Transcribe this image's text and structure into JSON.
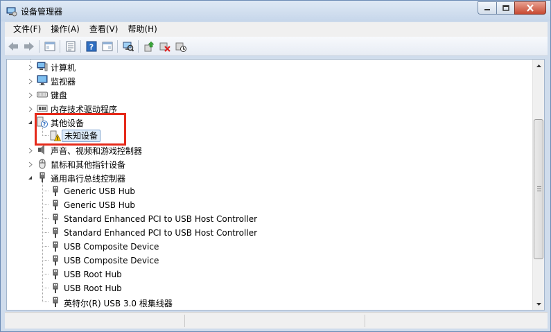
{
  "window": {
    "title": "设备管理器"
  },
  "menu": [
    "文件(F)",
    "操作(A)",
    "查看(V)",
    "帮助(H)"
  ],
  "toolbar": {
    "buttons": [
      "back-icon",
      "forward-icon",
      "show-hide-console-tree-icon",
      "properties-icon",
      "help-icon",
      "action-pane-icon",
      "scan-hardware-icon",
      "update-driver-icon",
      "uninstall-icon",
      "disable-icon"
    ]
  },
  "tree": {
    "categories": [
      {
        "label": "计算机",
        "icon": "computer-icon",
        "expanded": false
      },
      {
        "label": "监视器",
        "icon": "monitor-icon",
        "expanded": false
      },
      {
        "label": "键盘",
        "icon": "keyboard-icon",
        "expanded": false
      },
      {
        "label": "内存技术驱动程序",
        "icon": "memory-icon",
        "expanded": false
      },
      {
        "label": "其他设备",
        "icon": "unknown-device-icon",
        "expanded": true
      },
      {
        "label": "声音、视频和游戏控制器",
        "icon": "sound-icon",
        "expanded": false
      },
      {
        "label": "鼠标和其他指针设备",
        "icon": "mouse-icon",
        "expanded": false
      },
      {
        "label": "通用串行总线控制器",
        "icon": "usb-icon",
        "expanded": true
      }
    ],
    "other_devices": [
      "未知设备"
    ],
    "usb_devices": [
      "Generic USB Hub",
      "Generic USB Hub",
      "Standard Enhanced PCI to USB Host Controller",
      "Standard Enhanced PCI to USB Host Controller",
      "USB Composite Device",
      "USB Composite Device",
      "USB Root Hub",
      "USB Root Hub",
      "英特尔(R) USB 3.0 根集线器"
    ]
  },
  "colors": {
    "highlight": "#e52a1a",
    "selection": "#dceaf8"
  }
}
